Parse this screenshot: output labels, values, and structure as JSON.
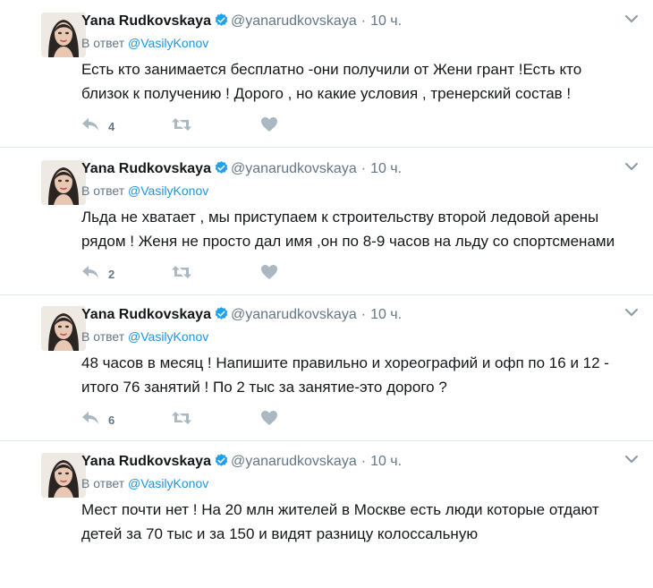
{
  "icons": {
    "verified": "verified-badge-icon",
    "caret": "chevron-down-icon",
    "reply": "reply-icon",
    "retweet": "retweet-icon",
    "like": "heart-icon"
  },
  "colors": {
    "link": "#1b95e0",
    "secondary_text": "#657786",
    "verified": "#1da1f2",
    "action_icon": "#aab8c2"
  },
  "tweets": [
    {
      "name": "Yana Rudkovskaya",
      "handle": "@yanarudkovskaya",
      "time": "10 ч.",
      "reply_prefix": "В ответ",
      "reply_to": "@VasilyKonov",
      "lines": [
        "Есть кто занимается бесплатно -они получили от Жени грант !Есть кто",
        "близок к получению ! Дорого , но какие условия , тренерский состав !"
      ],
      "reply_count": "4"
    },
    {
      "name": "Yana Rudkovskaya",
      "handle": "@yanarudkovskaya",
      "time": "10 ч.",
      "reply_prefix": "В ответ",
      "reply_to": "@VasilyKonov",
      "lines": [
        "Льда не хватает , мы приступаем к строительству второй ледовой арены",
        "рядом ! Женя не просто дал имя ,он по 8-9 часов на льду со спортсменами"
      ],
      "reply_count": "2"
    },
    {
      "name": "Yana Rudkovskaya",
      "handle": "@yanarudkovskaya",
      "time": "10 ч.",
      "reply_prefix": "В ответ",
      "reply_to": "@VasilyKonov",
      "lines": [
        "48 часов в месяц ! Напишите правильно и хореографий и офп по 16 и 12 -",
        "итого 76 занятий ! По 2 тыс за занятие-это дорого ?"
      ],
      "reply_count": "6"
    },
    {
      "name": "Yana Rudkovskaya",
      "handle": "@yanarudkovskaya",
      "time": "10 ч.",
      "reply_prefix": "В ответ",
      "reply_to": "@VasilyKonov",
      "lines": [
        "Мест почти нет ! На 20 млн жителей в Москве есть люди которые отдают",
        "детей за 70 тыс и за 150 и видят разницу колоссальную"
      ]
    }
  ]
}
